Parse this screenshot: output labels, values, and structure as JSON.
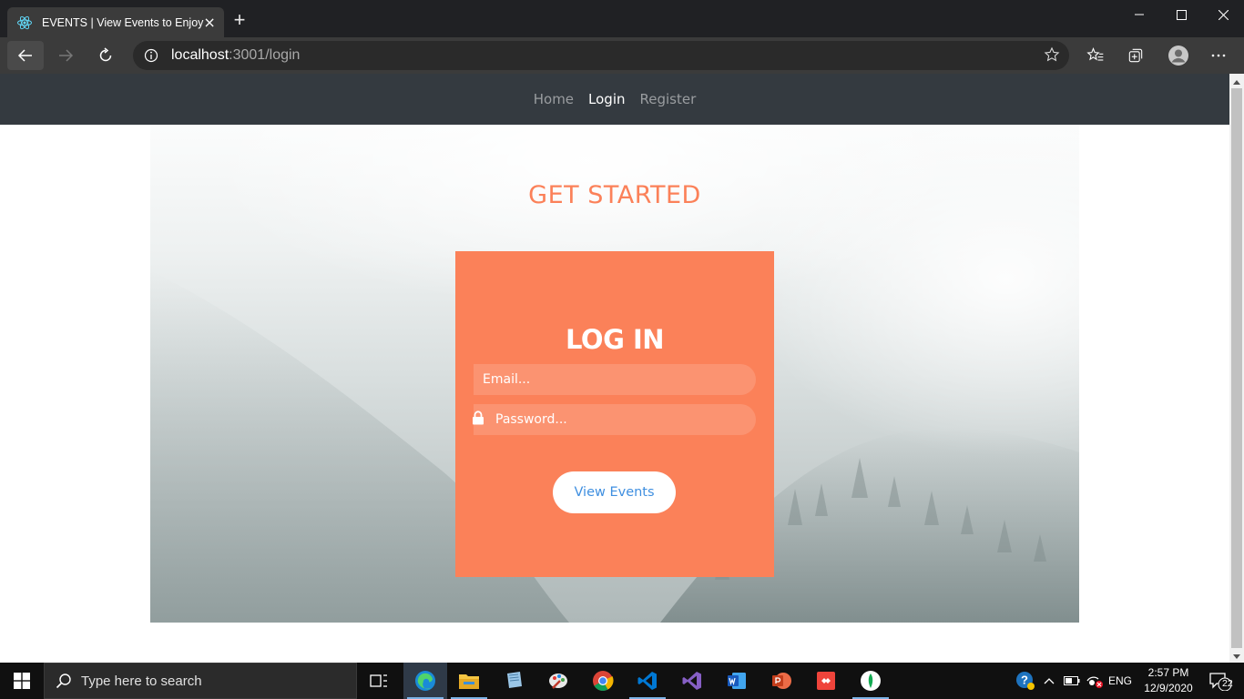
{
  "browser": {
    "tab_title": "EVENTS | View Events to Enjoy",
    "tab_close": "×",
    "new_tab": "+",
    "url_host": "localhost",
    "url_path": ":3001/login"
  },
  "site": {
    "nav": {
      "home": "Home",
      "login": "Login",
      "register": "Register"
    },
    "hero_title": "GET STARTED",
    "login_card": {
      "title": "LOG IN",
      "email_placeholder": "Email...",
      "password_placeholder": "Password...",
      "submit_label": "View Events"
    }
  },
  "taskbar": {
    "search_placeholder": "Type here to search",
    "language": "ENG",
    "time": "2:57 PM",
    "date": "12/9/2020",
    "notification_count": "22"
  },
  "colors": {
    "accent": "#fb8159",
    "navbar": "#343a40",
    "button_text": "#3f8fe0"
  }
}
